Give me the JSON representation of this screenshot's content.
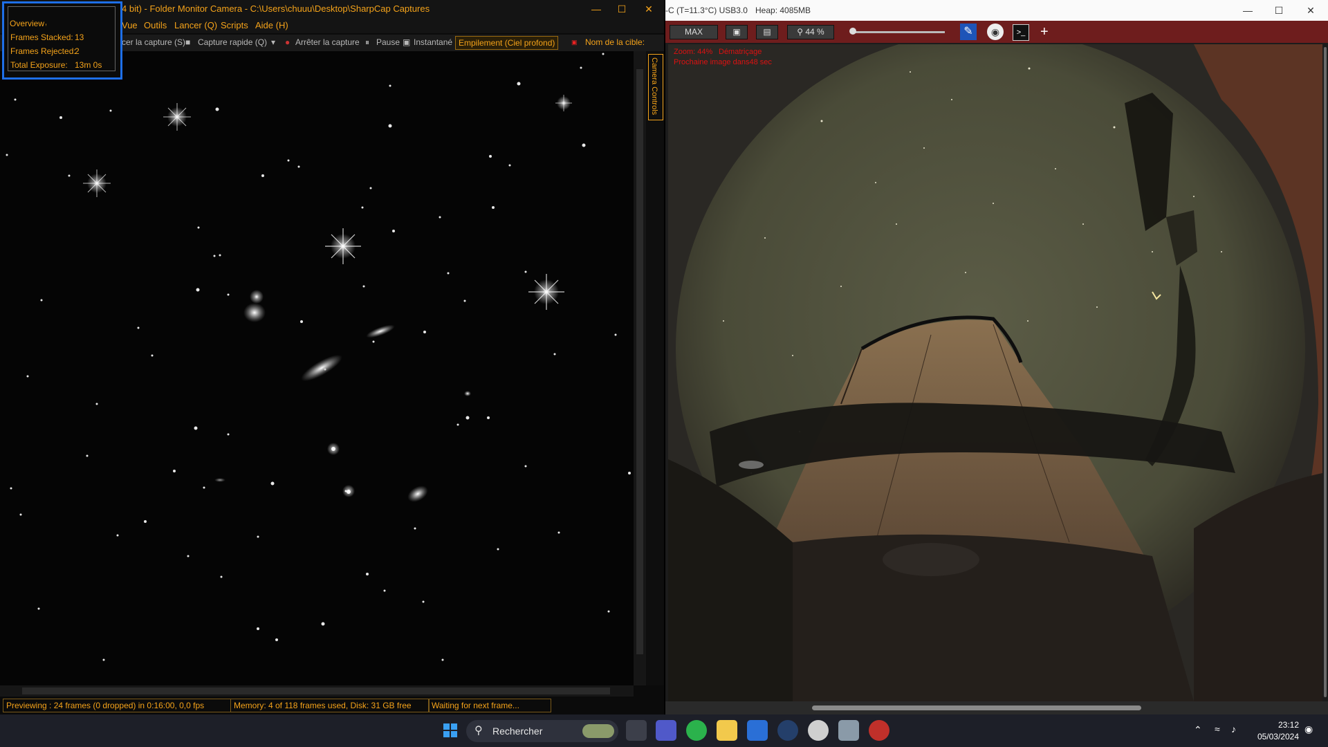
{
  "sharpcap": {
    "title": "4 bit) - Folder Monitor Camera - C:\\Users\\chuuu\\Desktop\\SharpCap Captures",
    "menu": [
      "Vue",
      "Outils",
      "Lancer (Q)",
      "Scripts",
      "Aide (H)"
    ],
    "toolbar": {
      "start_capture": "cer la capture (S)",
      "quick_capture": "Capture rapide (Q)",
      "stop_capture": "Arrêter la capture",
      "pause": "Pause",
      "snapshot": "Instantané",
      "live_stack": "Empilement (Ciel profond)",
      "target_name": "Nom de la cible:"
    },
    "side_tab": "Camera Controls",
    "overview": {
      "legend": "Overview",
      "frames_stacked_label": "Frames Stacked:",
      "frames_stacked": "13",
      "frames_rejected_label": "Frames Rejected:",
      "frames_rejected": "2",
      "total_exposure_label": "Total Exposure:",
      "total_exposure": "13m 0s"
    },
    "status": {
      "preview": "Previewing : 24 frames (0 dropped) in 0:16:00, 0,0 fps",
      "memory": "Memory: 4 of 118 frames used, Disk: 31 GB free",
      "waiting": "Waiting for next frame..."
    }
  },
  "allsky": {
    "title_camera": "-C (T=11.3°C) USB3.0",
    "title_heap": "Heap: 4085MB",
    "toolbar": {
      "max": "MAX",
      "zoom": "44 %"
    },
    "overlay": {
      "zoom": "Zoom: 44%",
      "debayer": "Dématriçage",
      "next_image": "Prochaine image dans48 sec"
    }
  },
  "taskbar": {
    "search_placeholder": "Rechercher",
    "time": "23:12",
    "date": "05/03/2024"
  },
  "colors": {
    "sharpcap_accent": "#f5a31a",
    "overview_border": "#1e6fe8",
    "allsky_toolbar": "#6e1d1d"
  }
}
